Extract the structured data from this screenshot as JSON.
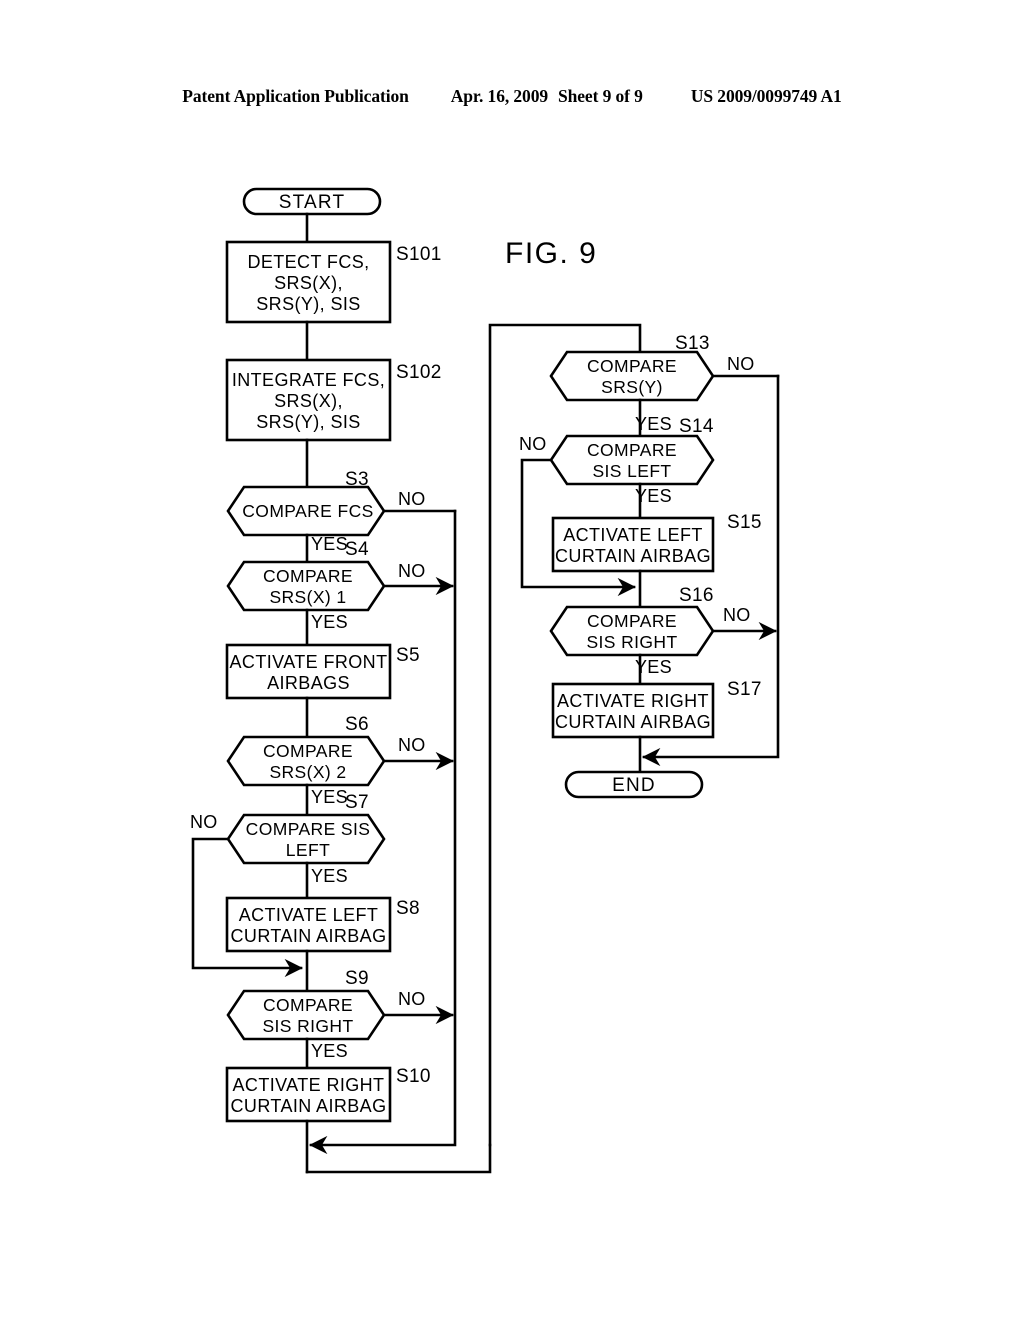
{
  "header": {
    "publication": "Patent Application Publication",
    "date": "Apr. 16, 2009",
    "sheet": "Sheet 9 of 9",
    "patent_number": "US 2009/0099749 A1"
  },
  "figure": {
    "label": "FIG. 9"
  },
  "flowchart": {
    "type": "flowchart",
    "terminators": {
      "start": "START",
      "end": "END"
    },
    "nodes": [
      {
        "id": "start",
        "shape": "terminator",
        "text": "START",
        "step": ""
      },
      {
        "id": "s101",
        "shape": "process",
        "text": "DETECT FCS,\nSRS(X),\nSRS(Y),  SIS",
        "step": "S101"
      },
      {
        "id": "s102",
        "shape": "process",
        "text": "INTEGRATE FCS,\nSRS(X),\nSRS(Y),  SIS",
        "step": "S102"
      },
      {
        "id": "s3",
        "shape": "decision",
        "text": "COMPARE FCS",
        "step": "S3"
      },
      {
        "id": "s4",
        "shape": "decision",
        "text": "COMPARE\nSRS(X) 1",
        "step": "S4"
      },
      {
        "id": "s5",
        "shape": "process",
        "text": "ACTIVATE FRONT\nAIRBAGS",
        "step": "S5"
      },
      {
        "id": "s6",
        "shape": "decision",
        "text": "COMPARE\nSRS(X) 2",
        "step": "S6"
      },
      {
        "id": "s7",
        "shape": "decision",
        "text": "COMPARE SIS\nLEFT",
        "step": "S7"
      },
      {
        "id": "s8",
        "shape": "process",
        "text": "ACTIVATE LEFT\nCURTAIN AIRBAG",
        "step": "S8"
      },
      {
        "id": "s9",
        "shape": "decision",
        "text": "COMPARE\nSIS RIGHT",
        "step": "S9"
      },
      {
        "id": "s10",
        "shape": "process",
        "text": "ACTIVATE RIGHT\nCURTAIN AIRBAG",
        "step": "S10"
      },
      {
        "id": "s13",
        "shape": "decision",
        "text": "COMPARE\nSRS(Y)",
        "step": "S13"
      },
      {
        "id": "s14",
        "shape": "decision",
        "text": "COMPARE\nSIS LEFT",
        "step": "S14"
      },
      {
        "id": "s15",
        "shape": "process",
        "text": "ACTIVATE LEFT\nCURTAIN AIRBAG",
        "step": "S15"
      },
      {
        "id": "s16",
        "shape": "decision",
        "text": "COMPARE\nSIS RIGHT",
        "step": "S16"
      },
      {
        "id": "s17",
        "shape": "process",
        "text": "ACTIVATE RIGHT\nCURTAIN AIRBAG",
        "step": "S17"
      },
      {
        "id": "end",
        "shape": "terminator",
        "text": "END",
        "step": ""
      }
    ],
    "edge_labels": {
      "s3_no": "NO",
      "s3_yes": "YES",
      "s4_no": "NO",
      "s4_yes": "YES",
      "s6_no": "NO",
      "s6_yes": "YES",
      "s7_no": "NO",
      "s7_yes": "YES",
      "s9_no": "NO",
      "s9_yes": "YES",
      "s13_no": "NO",
      "s13_yes": "YES",
      "s14_no": "NO",
      "s14_yes": "YES",
      "s16_no": "NO",
      "s16_yes": "YES"
    },
    "step_labels": {
      "s101": "S101",
      "s102": "S102",
      "s3": "S3",
      "s4": "S4",
      "s5": "S5",
      "s6": "S6",
      "s7": "S7",
      "s8": "S8",
      "s9": "S9",
      "s10": "S10",
      "s13": "S13",
      "s14": "S14",
      "s15": "S15",
      "s16": "S16",
      "s17": "S17"
    }
  },
  "colors": {
    "ink": "#000000",
    "paper": "#ffffff"
  }
}
